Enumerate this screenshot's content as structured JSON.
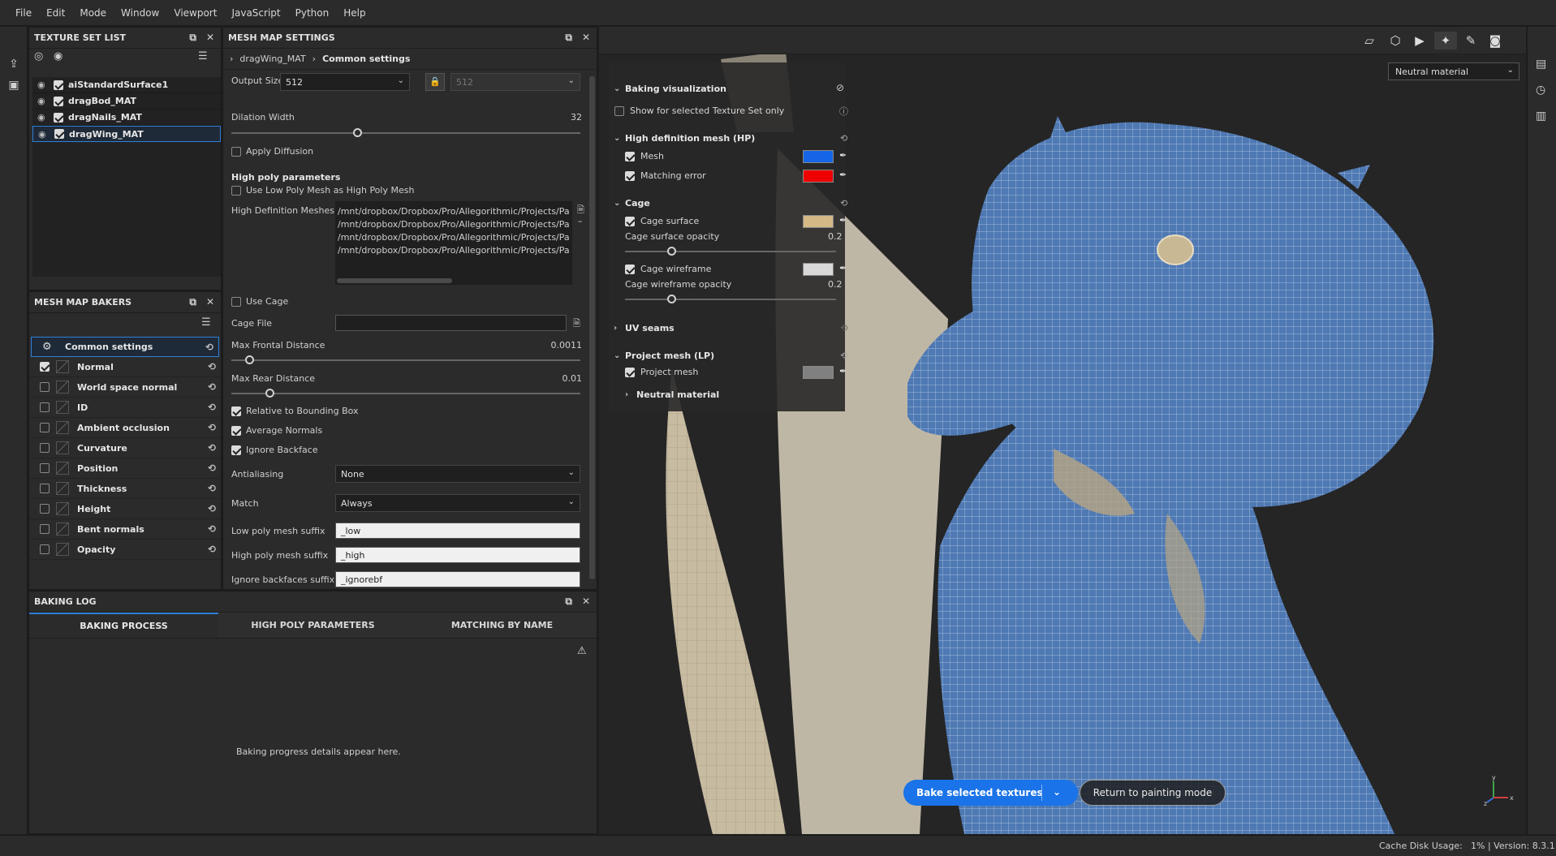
{
  "menu": [
    "File",
    "Edit",
    "Mode",
    "Window",
    "Viewport",
    "JavaScript",
    "Python",
    "Help"
  ],
  "texture_set_list": {
    "title": "TEXTURE SET LIST",
    "items": [
      {
        "label": "aiStandardSurface1",
        "checked": true
      },
      {
        "label": "dragBod_MAT",
        "checked": true
      },
      {
        "label": "dragNails_MAT",
        "checked": true
      },
      {
        "label": "dragWing_MAT",
        "checked": true,
        "selected": true
      }
    ]
  },
  "mesh_map_bakers": {
    "title": "MESH MAP BAKERS",
    "common": "Common settings",
    "items": [
      {
        "label": "Normal",
        "checked": true
      },
      {
        "label": "World space normal",
        "checked": false
      },
      {
        "label": "ID",
        "checked": false
      },
      {
        "label": "Ambient occlusion",
        "checked": false
      },
      {
        "label": "Curvature",
        "checked": false
      },
      {
        "label": "Position",
        "checked": false
      },
      {
        "label": "Thickness",
        "checked": false
      },
      {
        "label": "Height",
        "checked": false
      },
      {
        "label": "Bent normals",
        "checked": false
      },
      {
        "label": "Opacity",
        "checked": false
      }
    ]
  },
  "mesh_map_settings": {
    "title": "MESH MAP SETTINGS",
    "crumb_root": "dragWing_MAT",
    "crumb_current": "Common settings",
    "output_size_label": "Output Size",
    "output_size": "512",
    "output_size_locked": "512",
    "dilation_label": "Dilation Width",
    "dilation_value": "32",
    "dilation_fraction": 0.36,
    "apply_diffusion": "Apply Diffusion",
    "high_poly_header": "High poly parameters",
    "use_low_poly": "Use Low Poly Mesh as High Poly Mesh",
    "hd_meshes_label": "High Definition Meshes",
    "hd_meshes": [
      "/mnt/dropbox/Dropbox/Pro/Allegorithmic/Projects/Pa",
      "/mnt/dropbox/Dropbox/Pro/Allegorithmic/Projects/Pa",
      "/mnt/dropbox/Dropbox/Pro/Allegorithmic/Projects/Pa",
      "/mnt/dropbox/Dropbox/Pro/Allegorithmic/Projects/Pa"
    ],
    "use_cage": "Use Cage",
    "cage_file_label": "Cage File",
    "cage_file": "",
    "max_frontal_label": "Max Frontal Distance",
    "max_frontal_value": "0.0011",
    "max_frontal_fraction": 0.05,
    "max_rear_label": "Max Rear Distance",
    "max_rear_value": "0.01",
    "max_rear_fraction": 0.11,
    "relative_bbox": "Relative to Bounding Box",
    "average_normals": "Average Normals",
    "ignore_backface": "Ignore Backface",
    "antialiasing_label": "Antialiasing",
    "antialiasing": "None",
    "match_label": "Match",
    "match": "Always",
    "low_suffix_label": "Low poly mesh suffix",
    "low_suffix": "_low",
    "high_suffix_label": "High poly mesh suffix",
    "high_suffix": "_high",
    "ignore_suffix_label": "Ignore backfaces suffix",
    "ignore_suffix": "_ignorebf"
  },
  "baking_log": {
    "title": "BAKING LOG",
    "tabs": [
      "BAKING PROCESS",
      "HIGH POLY PARAMETERS",
      "MATCHING BY NAME"
    ],
    "empty_message": "Baking progress details appear here."
  },
  "viewport": {
    "material_select": "Neutral material",
    "bake_button": "Bake selected textures",
    "return_button": "Return to painting mode",
    "viz": {
      "title": "Baking visualization",
      "show_selected": "Show for selected Texture Set only",
      "hp_section": "High definition mesh (HP)",
      "mesh": "Mesh",
      "mesh_color": "#1565e6",
      "matching_error": "Matching error",
      "matching_error_color": "#ee0000",
      "cage_section": "Cage",
      "cage_surface": "Cage surface",
      "cage_surface_color": "#d4b987",
      "cage_surface_opacity_label": "Cage surface opacity",
      "cage_surface_opacity": "0.2",
      "cage_wireframe": "Cage wireframe",
      "cage_wireframe_color": "#d8d8d8",
      "cage_wireframe_opacity_label": "Cage wireframe opacity",
      "cage_wireframe_opacity": "0.2",
      "uv_section": "UV seams",
      "lp_section": "Project mesh (LP)",
      "project_mesh": "Project mesh",
      "project_mesh_color": "#808080",
      "neutral_material": "Neutral material"
    },
    "gizmo": {
      "x": "x",
      "y": "y",
      "z": "z"
    }
  },
  "status": {
    "cache": "Cache Disk Usage:",
    "cache_value": "1% | Version: 8.3.1"
  }
}
